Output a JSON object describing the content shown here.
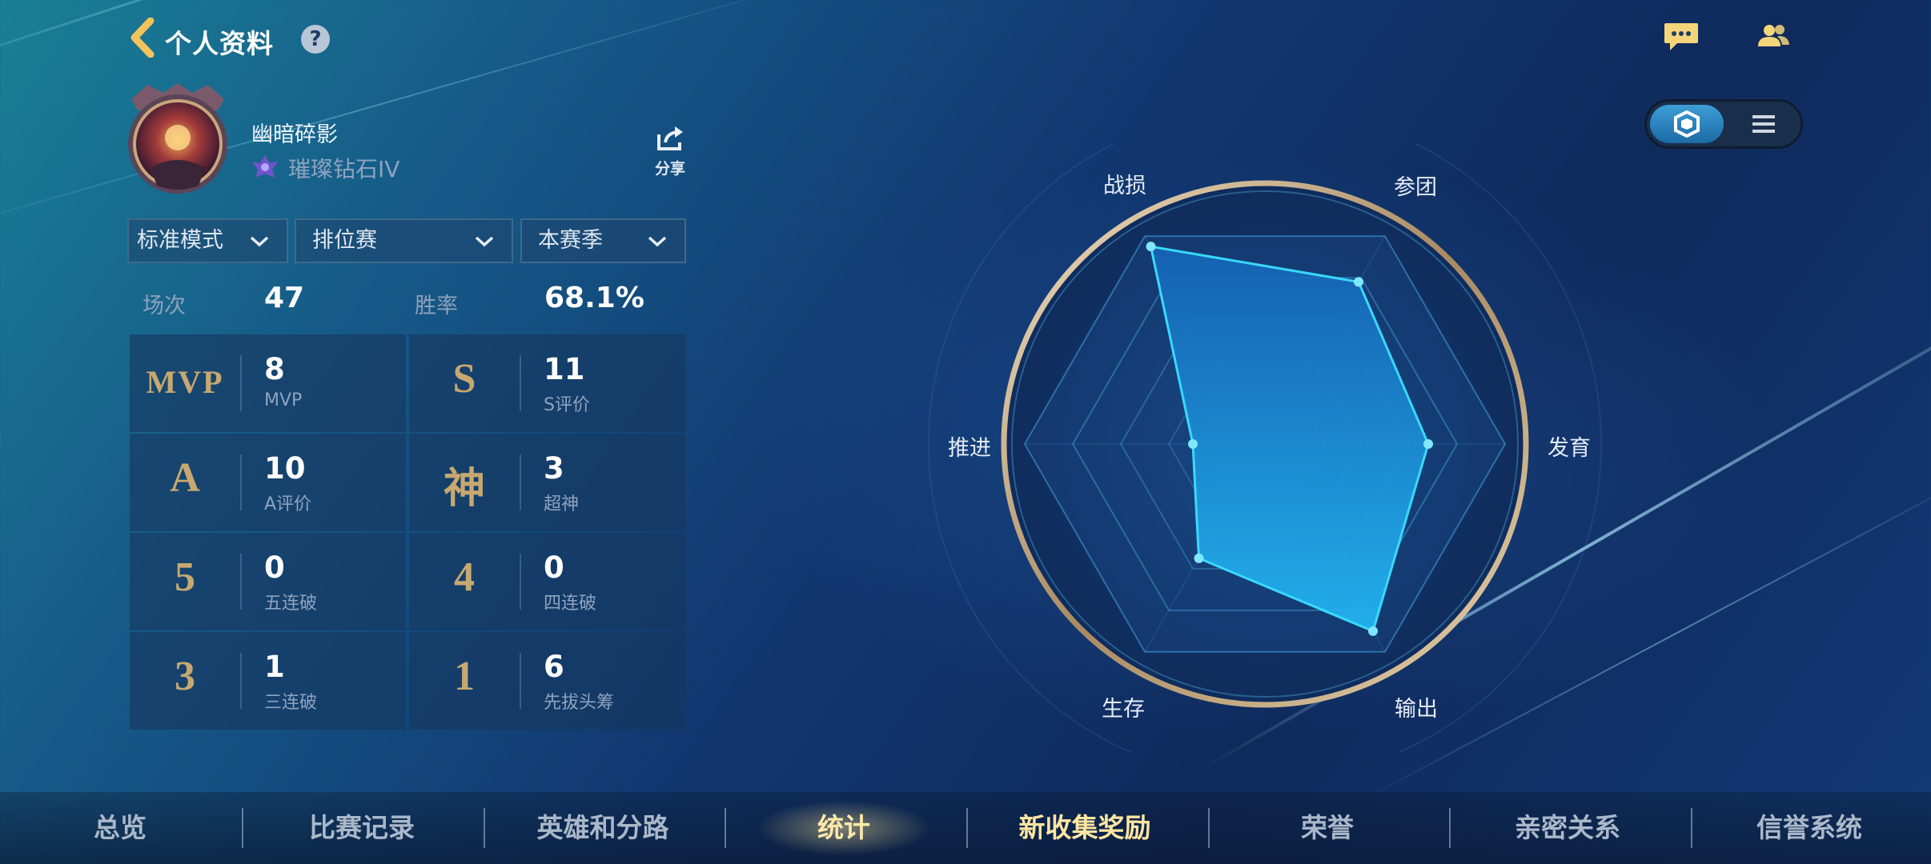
{
  "header": {
    "title": "个人资料",
    "help": "?"
  },
  "profile": {
    "username": "幽暗碎影",
    "rank": "璀璨钻石IV",
    "share_label": "分享"
  },
  "filters": [
    {
      "label": "标准模式"
    },
    {
      "label": "排位赛"
    },
    {
      "label": "本赛季"
    }
  ],
  "summary": {
    "matches_label": "场次",
    "matches_value": "47",
    "winrate_label": "胜率",
    "winrate_value": "68.1%"
  },
  "stats": [
    {
      "glyph": "MVP",
      "value": "8",
      "label": "MVP"
    },
    {
      "glyph": "S",
      "value": "11",
      "label": "S评价"
    },
    {
      "glyph": "A",
      "value": "10",
      "label": "A评价"
    },
    {
      "glyph": "神",
      "value": "3",
      "label": "超神"
    },
    {
      "glyph": "5",
      "value": "0",
      "label": "五连破"
    },
    {
      "glyph": "4",
      "value": "0",
      "label": "四连破"
    },
    {
      "glyph": "3",
      "value": "1",
      "label": "三连破"
    },
    {
      "glyph": "1",
      "value": "6",
      "label": "先拔头筹"
    }
  ],
  "radar": {
    "axes": [
      "战损",
      "参团",
      "发育",
      "输出",
      "生存",
      "推进"
    ],
    "values": [
      0.95,
      0.78,
      0.68,
      0.9,
      0.55,
      0.3
    ],
    "fill_color": "#1e9be6",
    "stroke_color": "#39d8ff"
  },
  "tabs": [
    {
      "label": "总览"
    },
    {
      "label": "比赛记录"
    },
    {
      "label": "英雄和分路"
    },
    {
      "label": "统计"
    },
    {
      "label": "新收集奖励"
    },
    {
      "label": "荣誉"
    },
    {
      "label": "亲密关系"
    },
    {
      "label": "信誉系统"
    }
  ],
  "active_tab": "统计",
  "side_code": "4400075"
}
